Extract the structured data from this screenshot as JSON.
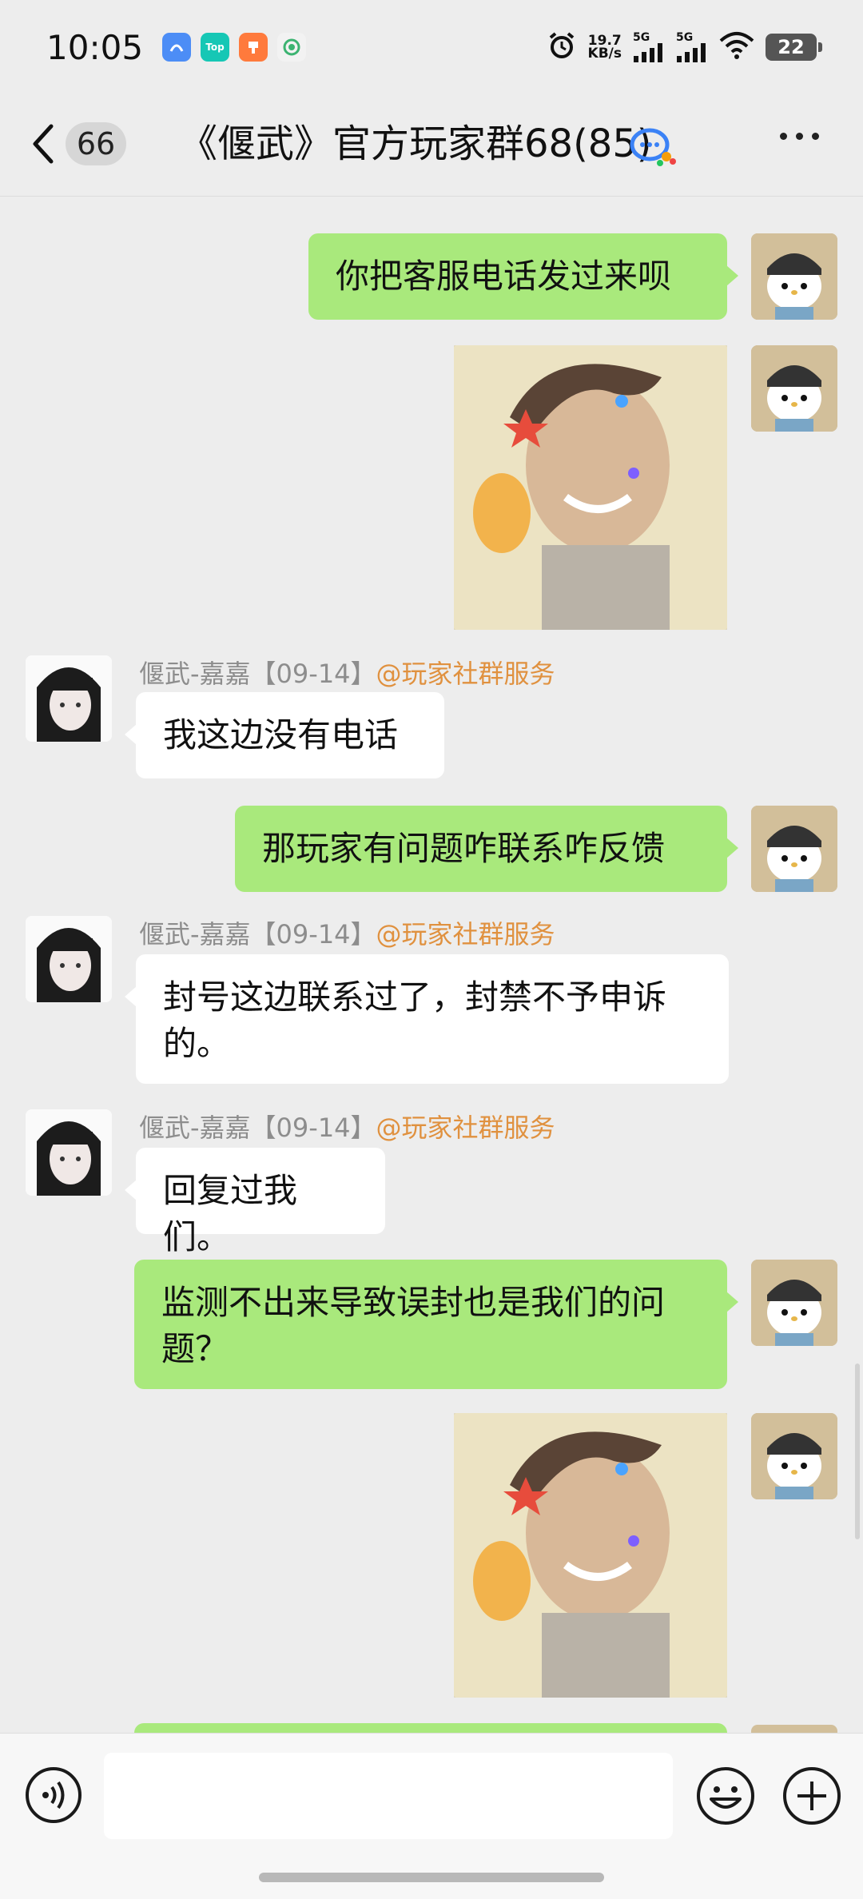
{
  "status_bar": {
    "time": "10:05",
    "apps": [
      {
        "icon": "blue-app-icon",
        "label": "",
        "color": "#4c8df6"
      },
      {
        "icon": "top-app-icon",
        "label": "Top",
        "color": "#16c7b5"
      },
      {
        "icon": "orange-app-icon",
        "label": "",
        "color": "#ff7a3c"
      },
      {
        "icon": "green-app-icon",
        "label": "",
        "color": "#3cb371"
      }
    ],
    "net_speed_value": "19.7",
    "net_speed_unit": "KB/s",
    "sim1_label": "5G",
    "sim2_label": "5G",
    "battery": "22"
  },
  "header": {
    "unread_count": "66",
    "title": "《偃武》官方玩家群68(85)"
  },
  "messages": [
    {
      "side": "right",
      "type": "text",
      "text": "你把客服电话发过来呗"
    },
    {
      "side": "right",
      "type": "image",
      "icon": "selfie-sticker-image"
    },
    {
      "side": "left",
      "sender": "偃武-嘉嘉【09-14】",
      "mention": "@玩家社群服务",
      "text": "我这边没有电话"
    },
    {
      "side": "right",
      "type": "text",
      "text": "那玩家有问题咋联系咋反馈"
    },
    {
      "side": "left",
      "sender": "偃武-嘉嘉【09-14】",
      "mention": "@玩家社群服务",
      "text": "封号这边联系过了，封禁不予申诉的。"
    },
    {
      "side": "left",
      "sender": "偃武-嘉嘉【09-14】",
      "mention": "@玩家社群服务",
      "text": "回复过我们。"
    },
    {
      "side": "right",
      "type": "text",
      "text": "监测不出来导致误封也是我们的问题？"
    },
    {
      "side": "right",
      "type": "image",
      "icon": "selfie-sticker-image"
    }
  ],
  "input": {
    "placeholder": ""
  },
  "colors": {
    "background": "#ededed",
    "bubble_self": "#a9e97c",
    "bubble_other": "#ffffff",
    "mention": "#e0913f"
  }
}
